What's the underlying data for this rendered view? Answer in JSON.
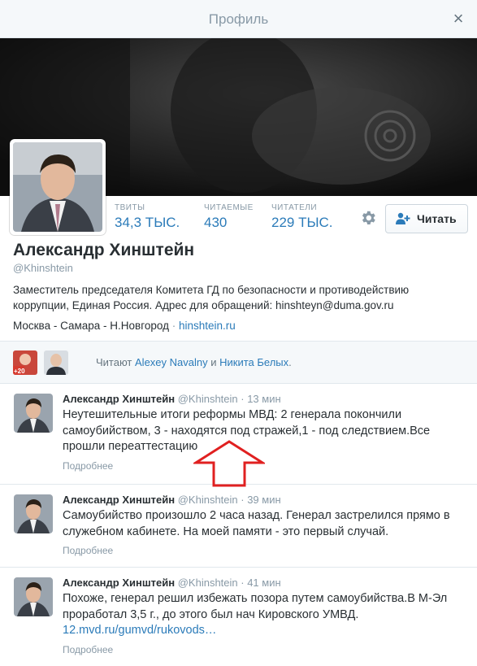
{
  "modal": {
    "title": "Профиль",
    "close_icon": "close-icon"
  },
  "profile": {
    "name": "Александр Хинштейн",
    "handle": "@Khinshtein",
    "bio": "Заместитель председателя Комитета ГД по безопасности и противодействию коррупции, Единая Россия.  Адрес для обращений: hinshteyn@duma.gov.ru",
    "location": "Москва - Самара - Н.Новгород",
    "separator": "·",
    "website": "hinshtein.ru",
    "stats": [
      {
        "label": "ТВИТЫ",
        "value": "34,3 ТЫС."
      },
      {
        "label": "ЧИТАЕМЫЕ",
        "value": "430"
      },
      {
        "label": "ЧИТАТЕЛИ",
        "value": "229 ТЫС."
      }
    ],
    "follow_label": "Читать"
  },
  "followed_by": {
    "prefix": "Читают",
    "user1": "Alexey Navalny",
    "conj": "и",
    "user2": "Никита Белых",
    "suffix": ".",
    "badge": "+20"
  },
  "tweets": [
    {
      "name": "Александр Хинштейн",
      "handle": "@Khinshtein",
      "time": "· 13 мин",
      "text": "Неутешительные итоги реформы МВД: 2 генерала покончили самоубийством, 3 - находятся под стражей,1 - под следствием.Все прошли переаттестацию",
      "link": "",
      "more": "Подробнее"
    },
    {
      "name": "Александр Хинштейн",
      "handle": "@Khinshtein",
      "time": "· 39 мин",
      "text": "Самоубийство произошло 2 часа назад. Генерал застрелился прямо в служебном кабинете. На моей памяти - это первый случай.",
      "link": "",
      "more": "Подробнее"
    },
    {
      "name": "Александр Хинштейн",
      "handle": "@Khinshtein",
      "time": "· 41 мин",
      "text": "Похоже, генерал решил избежать позора путем самоубийства.В М-Эл проработал 3,5 г., до этого был нач Кировского УМВД.",
      "link": "12.mvd.ru/gumvd/rukovods…",
      "more": "Подробнее"
    }
  ],
  "colors": {
    "link": "#2b7bb9",
    "muted": "#8899a6",
    "arrow": "#e02020"
  }
}
